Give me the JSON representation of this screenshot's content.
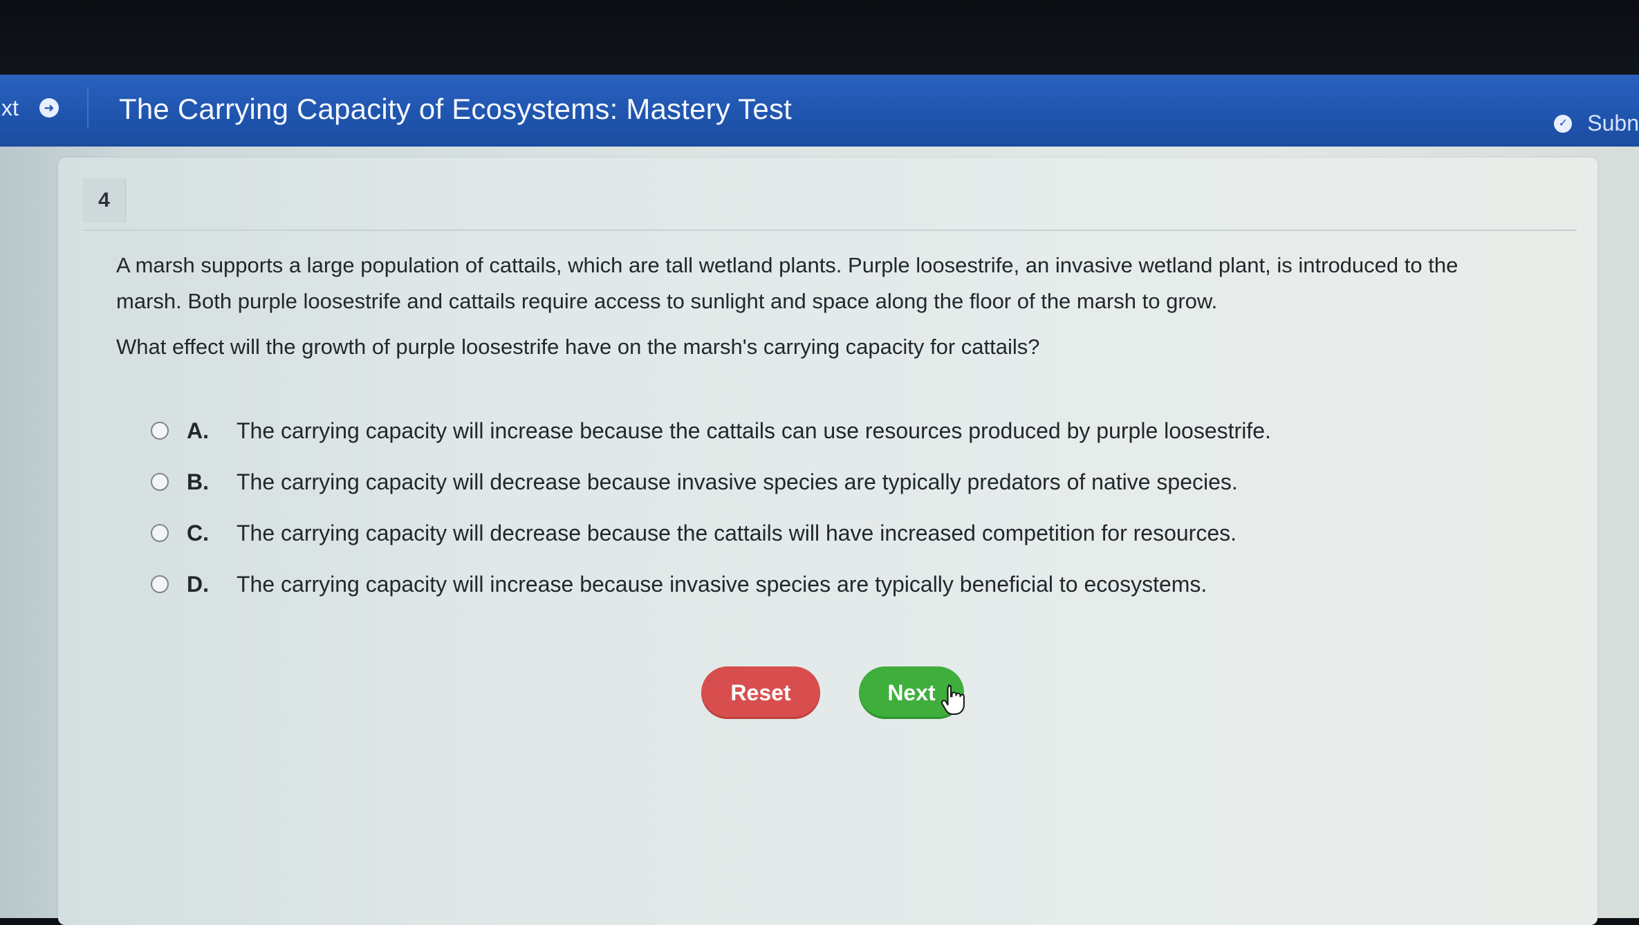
{
  "header": {
    "nav_text": "xt",
    "title": "The Carrying Capacity of Ecosystems: Mastery Test",
    "submit_label": "Subn"
  },
  "question": {
    "number": "4",
    "passage": "A marsh supports a large population of cattails, which are tall wetland plants. Purple loosestrife, an invasive wetland plant, is introduced to the marsh. Both purple loosestrife and cattails require access to sunlight and space along the floor of the marsh to grow.",
    "prompt": "What effect will the growth of purple loosestrife have on the marsh's carrying capacity for cattails?",
    "options": [
      {
        "letter": "A.",
        "text": "The carrying capacity will increase because the cattails can use resources produced by purple loosestrife."
      },
      {
        "letter": "B.",
        "text": "The carrying capacity will decrease because invasive species are typically predators of native species."
      },
      {
        "letter": "C.",
        "text": "The carrying capacity will decrease because the cattails will have increased competition for resources."
      },
      {
        "letter": "D.",
        "text": "The carrying capacity will increase because invasive species are typically beneficial to ecosystems."
      }
    ]
  },
  "buttons": {
    "reset_label": "Reset",
    "next_label": "Next"
  },
  "icons": {
    "nav_arrow": "arrow-right-circle-icon",
    "submit_check": "check-circle-icon",
    "cursor": "hand-pointer-cursor-icon"
  },
  "colors": {
    "header_blue": "#2a62bf",
    "reset_red": "#d84e4e",
    "next_green": "#3fae3c"
  }
}
